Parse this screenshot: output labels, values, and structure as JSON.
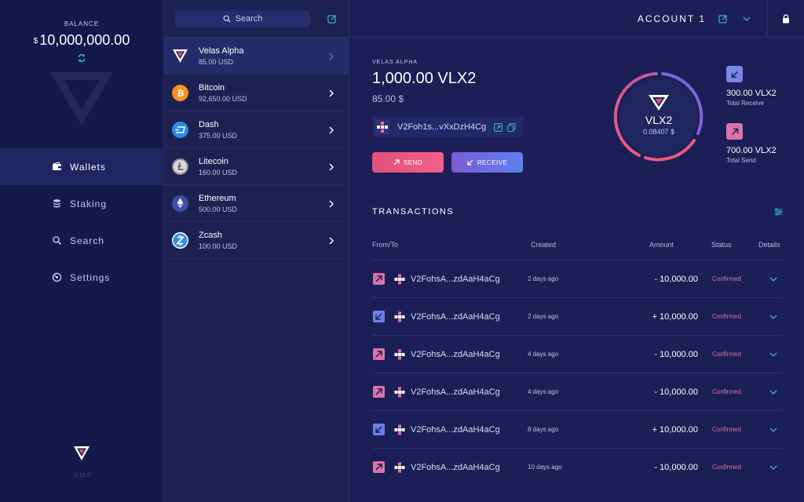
{
  "nav": {
    "balance_label": "BALANCE",
    "balance_currency": "$",
    "balance_value": "10,000,000.00",
    "items": [
      {
        "label": "Wallets",
        "icon": "wallet-icon",
        "active": true
      },
      {
        "label": "Staking",
        "icon": "database-icon",
        "active": false
      },
      {
        "label": "Search",
        "icon": "search-icon",
        "active": false
      },
      {
        "label": "Settings",
        "icon": "settings-icon",
        "active": false
      }
    ],
    "version": "0.13.0"
  },
  "wallets": {
    "search_label": "Search",
    "items": [
      {
        "name": "Velas Alpha",
        "usd": "85.00 USD",
        "icon": "velas-icon",
        "color": "#ffffff"
      },
      {
        "name": "Bitcoin",
        "usd": "92,650.00 USD",
        "icon": "bitcoin-icon",
        "color": "#f7931a"
      },
      {
        "name": "Dash",
        "usd": "375.00 USD",
        "icon": "dash-icon",
        "color": "#2b8be6"
      },
      {
        "name": "Litecoin",
        "usd": "160.00 USD",
        "icon": "litecoin-icon",
        "color": "#9a9a9a"
      },
      {
        "name": "Ethereum",
        "usd": "500.00 USD",
        "icon": "ethereum-icon",
        "color": "#5b7ad6"
      },
      {
        "name": "Zcash",
        "usd": "100.00 USD",
        "icon": "zcash-icon",
        "color": "#3a8de8"
      }
    ]
  },
  "topbar": {
    "account": "ACCOUNT 1"
  },
  "coin": {
    "label": "VELAS ALPHA",
    "amount": "1,000.00 VLX2",
    "usd": "85.00 $",
    "address": "V2Foh1s...vXxDzH4Cg",
    "send_label": "SEND",
    "receive_label": "RECEIVE",
    "symbol": "VLX2",
    "price": "0.08407 $",
    "total_receive_value": "300.00 VLX2",
    "total_receive_label": "Total Receive",
    "total_send_value": "700.00 VLX2",
    "total_send_label": "Total Send"
  },
  "transactions": {
    "title": "TRANSACTIONS",
    "headers": {
      "from_to": "From/To",
      "created": "Created",
      "amount": "Amount",
      "status": "Status",
      "details": "Details"
    },
    "rows": [
      {
        "dir": "send",
        "addr": "V2FohsA...zdAaH4aCg",
        "created": "2 days ago",
        "amount": "- 10,000.00",
        "status": "Confirmed"
      },
      {
        "dir": "receive",
        "addr": "V2FohsA...zdAaH4aCg",
        "created": "2 days ago",
        "amount": "+ 10,000.00",
        "status": "Confirmed"
      },
      {
        "dir": "send",
        "addr": "V2FohsA...zdAaH4aCg",
        "created": "4 days ago",
        "amount": "- 10,000.00",
        "status": "Confirmed"
      },
      {
        "dir": "send",
        "addr": "V2FohsA...zdAaH4aCg",
        "created": "4 days ago",
        "amount": "- 10,000.00",
        "status": "Confirmed"
      },
      {
        "dir": "receive",
        "addr": "V2FohsA...zdAaH4aCg",
        "created": "8 days ago",
        "amount": "+ 10,000.00",
        "status": "Confirmed"
      },
      {
        "dir": "send",
        "addr": "V2FohsA...zdAaH4aCg",
        "created": "10 days ago",
        "amount": "- 10,000.00",
        "status": "Confirmed"
      }
    ]
  },
  "colors": {
    "send": "#e2507c",
    "receive": "#5f7ef0",
    "confirmed": "#d977b0",
    "accent": "#3fb0c9"
  }
}
